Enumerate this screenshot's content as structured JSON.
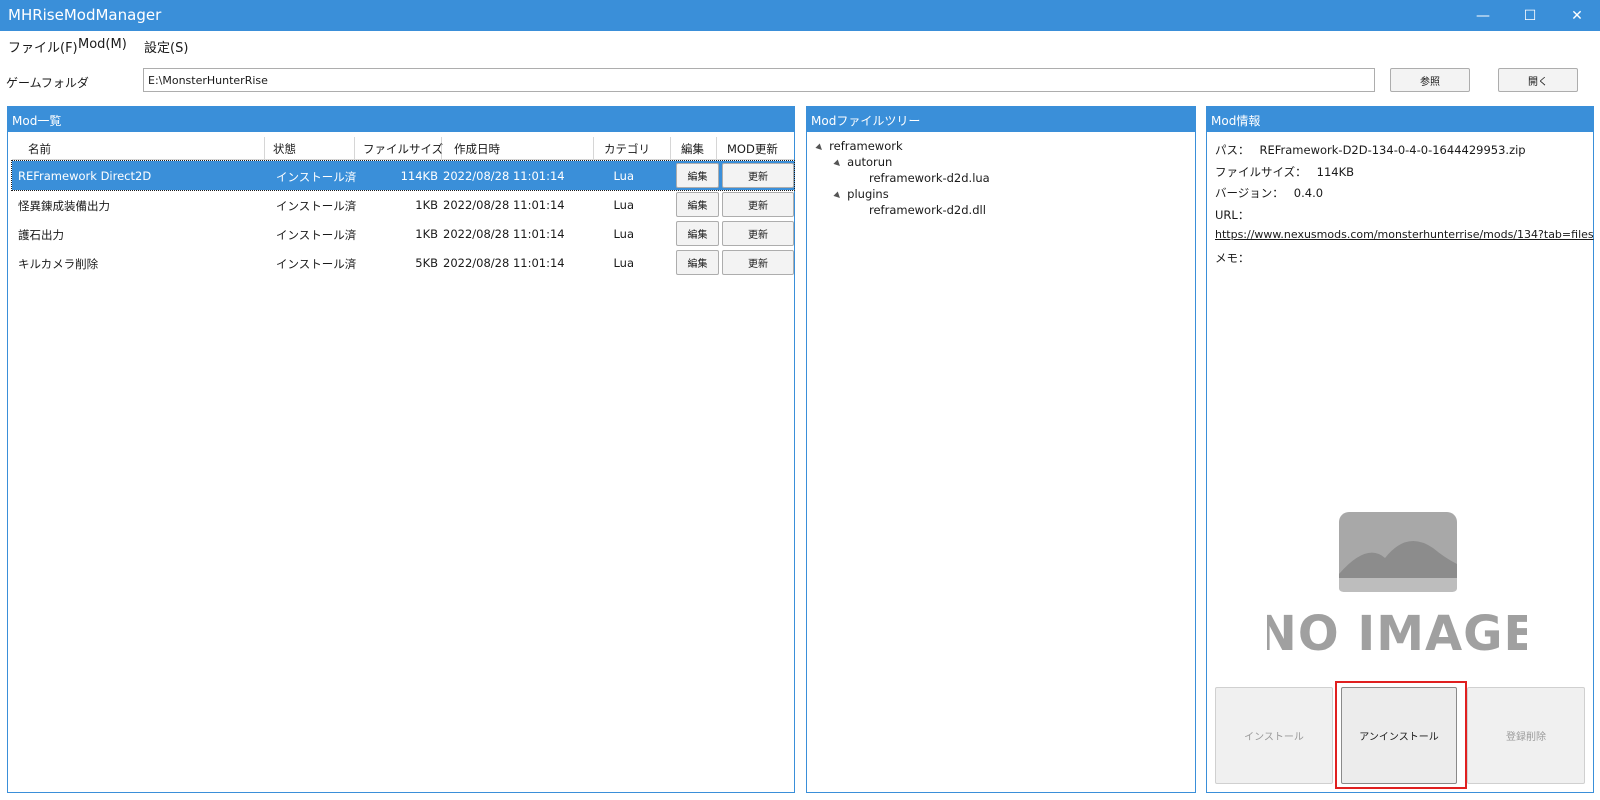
{
  "window": {
    "title": "MHRiseModManager",
    "minimize": "—",
    "maximize": "☐",
    "close": "✕"
  },
  "menu": {
    "file": "ファイル(F)",
    "mod": "Mod(M)",
    "settings": "設定(S)"
  },
  "game_folder": {
    "label": "ゲームフォルダ",
    "path": "E:\\MonsterHunterRise",
    "browse": "参照",
    "open": "開く"
  },
  "mod_list": {
    "title": "Mod一覧",
    "columns": {
      "name": "名前",
      "status": "状態",
      "size": "ファイルサイズ",
      "date": "作成日時",
      "category": "カテゴリ",
      "edit": "編集",
      "update": "MOD更新"
    },
    "rows": [
      {
        "name": "REFramework Direct2D",
        "status": "インストール済",
        "size": "114KB",
        "date": "2022/08/28 11:01:14",
        "category": "Lua",
        "edit": "編集",
        "update": "更新",
        "selected": true
      },
      {
        "name": "怪異錬成装備出力",
        "status": "インストール済",
        "size": "1KB",
        "date": "2022/08/28 11:01:14",
        "category": "Lua",
        "edit": "編集",
        "update": "更新",
        "selected": false
      },
      {
        "name": "護石出力",
        "status": "インストール済",
        "size": "1KB",
        "date": "2022/08/28 11:01:14",
        "category": "Lua",
        "edit": "編集",
        "update": "更新",
        "selected": false
      },
      {
        "name": "キルカメラ削除",
        "status": "インストール済",
        "size": "5KB",
        "date": "2022/08/28 11:01:14",
        "category": "Lua",
        "edit": "編集",
        "update": "更新",
        "selected": false
      }
    ]
  },
  "file_tree": {
    "title": "Modファイルツリー",
    "root": "reframework",
    "autorun": "autorun",
    "autorun_file": "reframework-d2d.lua",
    "plugins": "plugins",
    "plugins_file": "reframework-d2d.dll"
  },
  "mod_info": {
    "title": "Mod情報",
    "path_label": "パス：",
    "path_value": "REFramework-D2D-134-0-4-0-1644429953.zip",
    "size_label": "ファイルサイズ：",
    "size_value": "114KB",
    "version_label": "バージョン：",
    "version_value": "0.4.0",
    "url_label": "URL：",
    "url_value": "https://www.nexusmods.com/monsterhunterrise/mods/134?tab=files",
    "memo_label": "メモ：",
    "no_image_text": "NO IMAGE",
    "install": "インストール",
    "uninstall": "アンインストール",
    "delete": "登録削除"
  }
}
